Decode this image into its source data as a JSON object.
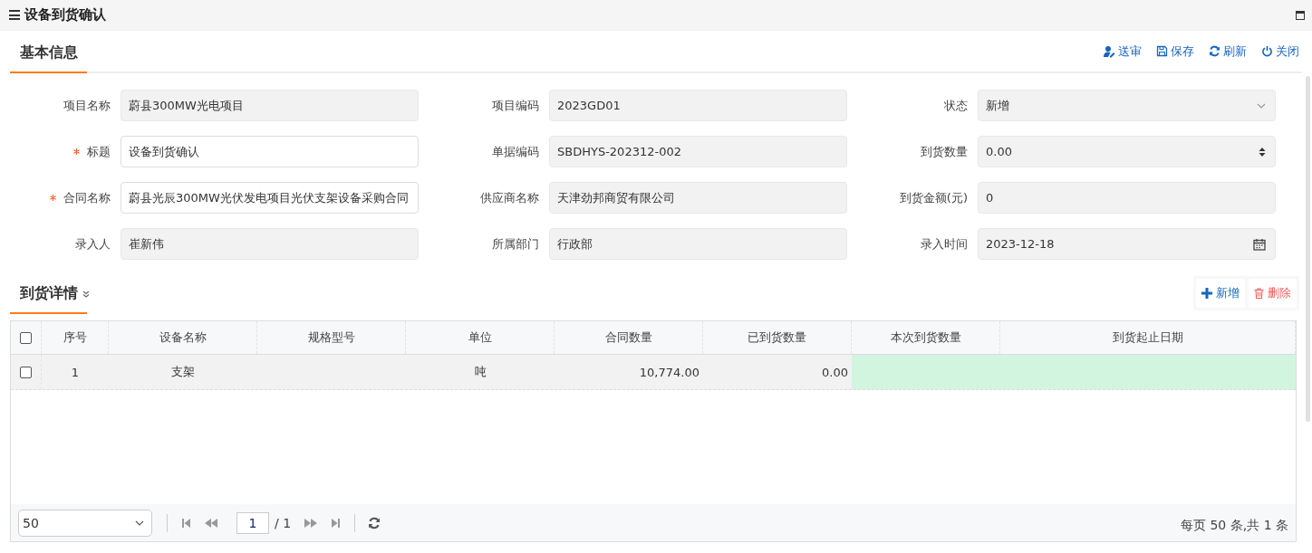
{
  "window": {
    "title": "设备到货确认"
  },
  "toolbar": [
    {
      "kind": "submit",
      "label": "送审"
    },
    {
      "kind": "save",
      "label": "保存"
    },
    {
      "kind": "refresh",
      "label": "刷新"
    },
    {
      "kind": "close",
      "label": "关闭"
    }
  ],
  "form_tab": {
    "label": "基本信息",
    "selected": true
  },
  "fields": [
    {
      "label": "项目名称",
      "value": "蔚县300MW光电项目",
      "required": false,
      "disabled": true,
      "kind": "text"
    },
    {
      "label": "项目编码",
      "value": "2023GD01",
      "required": false,
      "disabled": true,
      "kind": "text"
    },
    {
      "label": "状态",
      "value": "新增",
      "required": false,
      "disabled": true,
      "kind": "select"
    },
    {
      "label": "标题",
      "value": "设备到货确认",
      "required": true,
      "disabled": false,
      "kind": "text"
    },
    {
      "label": "单据编码",
      "value": "SBDHYS-202312-002",
      "required": false,
      "disabled": true,
      "kind": "text"
    },
    {
      "label": "到货数量",
      "value": "0.00",
      "required": false,
      "disabled": true,
      "kind": "number"
    },
    {
      "label": "合同名称",
      "value": "蔚县光辰300MW光伏发电项目光伏支架设备采购合同",
      "required": true,
      "disabled": false,
      "kind": "text"
    },
    {
      "label": "供应商名称",
      "value": "天津劲邦商贸有限公司",
      "required": false,
      "disabled": true,
      "kind": "text"
    },
    {
      "label": "到货金额(元)",
      "value": "0",
      "required": false,
      "disabled": true,
      "kind": "text"
    },
    {
      "label": "录入人",
      "value": "崔新伟",
      "required": false,
      "disabled": true,
      "kind": "text"
    },
    {
      "label": "所属部门",
      "value": "行政部",
      "required": false,
      "disabled": true,
      "kind": "text"
    },
    {
      "label": "录入时间",
      "value": "2023-12-18",
      "required": false,
      "disabled": true,
      "kind": "date"
    }
  ],
  "detail_tab": {
    "label": "到货详情",
    "selected": true
  },
  "detail_actions": [
    {
      "kind": "add",
      "label": "新增"
    },
    {
      "kind": "delete",
      "label": "删除"
    }
  ],
  "table": {
    "all_checked": false,
    "columns": [
      {
        "label": "序号",
        "kind": "text",
        "editable": false
      },
      {
        "label": "设备名称",
        "kind": "text",
        "editable": false
      },
      {
        "label": "规格型号",
        "kind": "text",
        "editable": false
      },
      {
        "label": "单位",
        "kind": "text",
        "editable": false
      },
      {
        "label": "合同数量",
        "kind": "number",
        "editable": false
      },
      {
        "label": "已到货数量",
        "kind": "number",
        "editable": false
      },
      {
        "label": "本次到货数量",
        "kind": "text",
        "editable": true
      },
      {
        "label": "到货起止日期",
        "kind": "text",
        "editable": true
      }
    ],
    "rows": [
      {
        "checked": false,
        "cells": [
          "1",
          "支架",
          "",
          "吨",
          "10,774.00",
          "0.00",
          "",
          ""
        ]
      }
    ]
  },
  "pager": {
    "page_size": "50",
    "page": "1",
    "total_pages": "/ 1",
    "summary": "每页 50 条,共 1 条"
  }
}
